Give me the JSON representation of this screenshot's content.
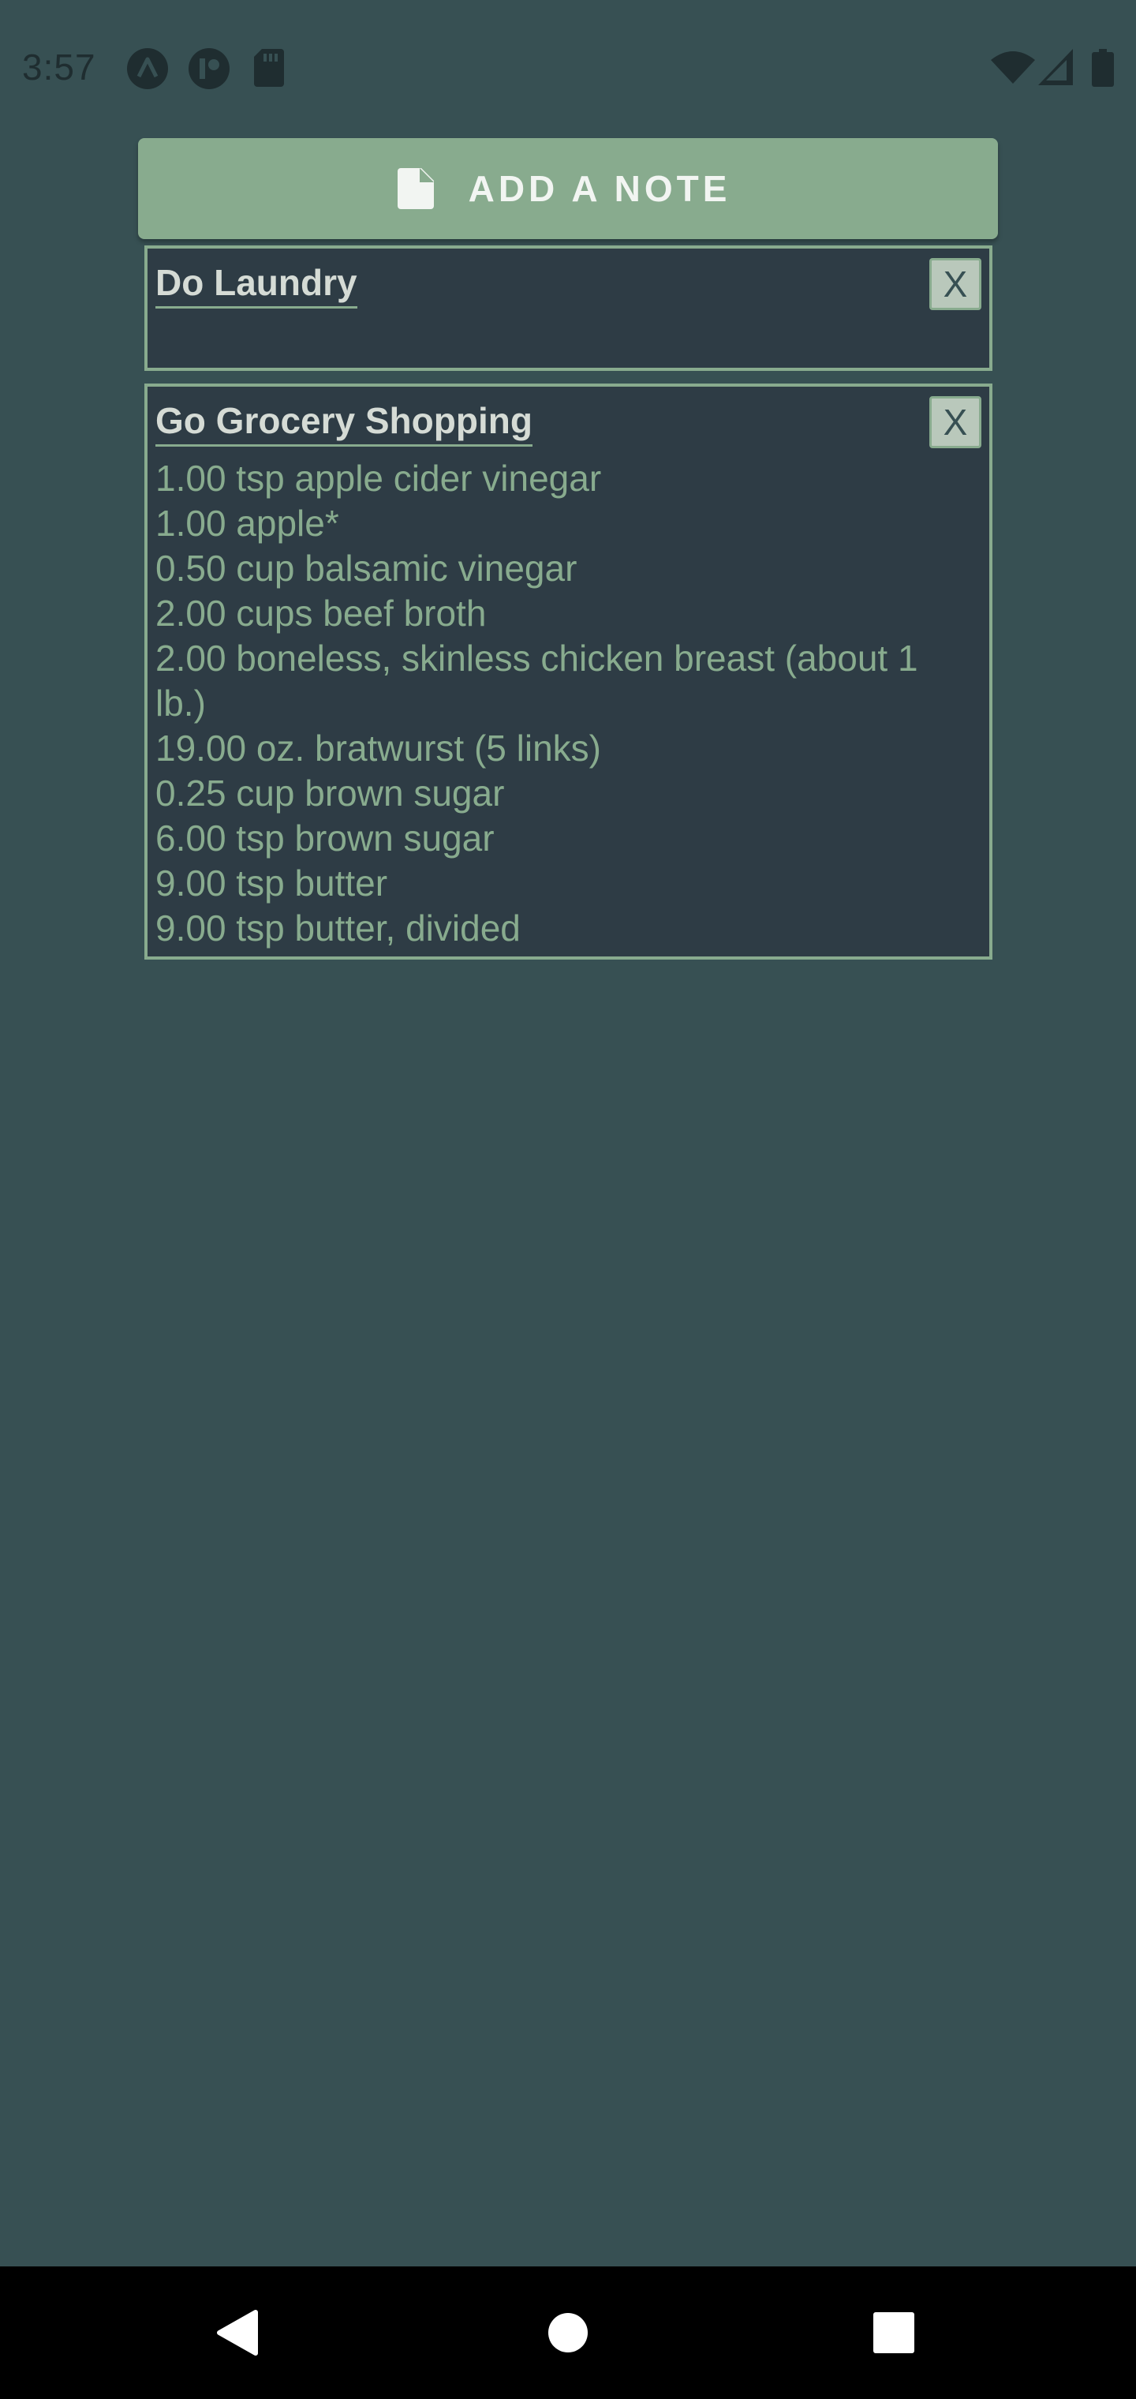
{
  "status_bar": {
    "time": "3:57",
    "icons_left": [
      "a-circle-icon",
      "notification-circle-icon",
      "sd-card-icon"
    ],
    "icons_right": [
      "wifi-icon",
      "cell-signal-icon",
      "battery-icon"
    ]
  },
  "add_note": {
    "label": "ADD A NOTE",
    "icon": "file-icon"
  },
  "notes": [
    {
      "title": "Do Laundry",
      "close_label": "X",
      "items": []
    },
    {
      "title": "Go Grocery Shopping",
      "close_label": "X",
      "items": [
        "1.00 tsp apple cider vinegar",
        "1.00 apple*",
        "0.50 cup balsamic vinegar",
        "2.00 cups beef broth",
        "2.00 boneless, skinless chicken breast (about 1",
        "lb.)",
        "19.00 oz. bratwurst (5 links)",
        "0.25 cup brown sugar",
        "6.00 tsp brown sugar",
        "9.00 tsp butter",
        "9.00 tsp butter, divided"
      ]
    }
  ],
  "nav_bar": {
    "buttons": [
      "back-icon",
      "home-icon",
      "recents-icon"
    ]
  },
  "colors": {
    "background": "#375053",
    "accent": "#88ab8e",
    "note_background": "#2e3c45",
    "title_text": "#d5dbd5"
  }
}
